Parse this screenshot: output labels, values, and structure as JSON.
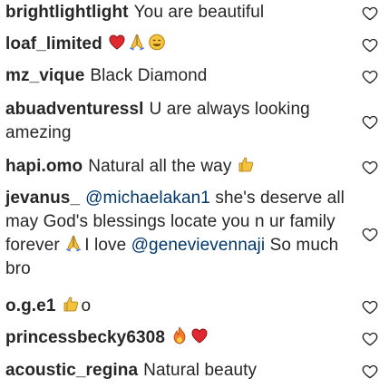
{
  "comments": [
    {
      "user": "brightlightlight",
      "text": "You are beautiful"
    },
    {
      "user": "loaf_limited",
      "text": "",
      "emojis": [
        "red-heart",
        "folded-hands",
        "smiling-face"
      ]
    },
    {
      "user": "mz_vique",
      "text": "Black Diamond"
    },
    {
      "user": "abuadventuressl",
      "text": "U are always looking amezing"
    },
    {
      "user": "hapi.omo",
      "text": "Natural all the way",
      "emojis_after": [
        "thumbs-up"
      ]
    },
    {
      "user": "jevanus_",
      "mention1": "@michaelakan1",
      "text1": "she's deserve all may God's blessings locate you n ur family forever",
      "emoji_mid": "folded-hands",
      "text2": "I love",
      "mention2": "@genevievennaji",
      "text3": "So much bro"
    },
    {
      "user": "o.g.e1",
      "text": "o",
      "emojis_before": [
        "thumbs-up"
      ]
    },
    {
      "user": "princessbecky6308",
      "text": "",
      "emojis": [
        "fire",
        "red-heart"
      ]
    },
    {
      "user": "acoustic_regina",
      "text": "Natural beauty"
    }
  ],
  "colors": {
    "text": "#262626",
    "mention": "#00376b",
    "heart_outline": "#262626"
  },
  "icons": {
    "like": "heart-outline-icon"
  }
}
